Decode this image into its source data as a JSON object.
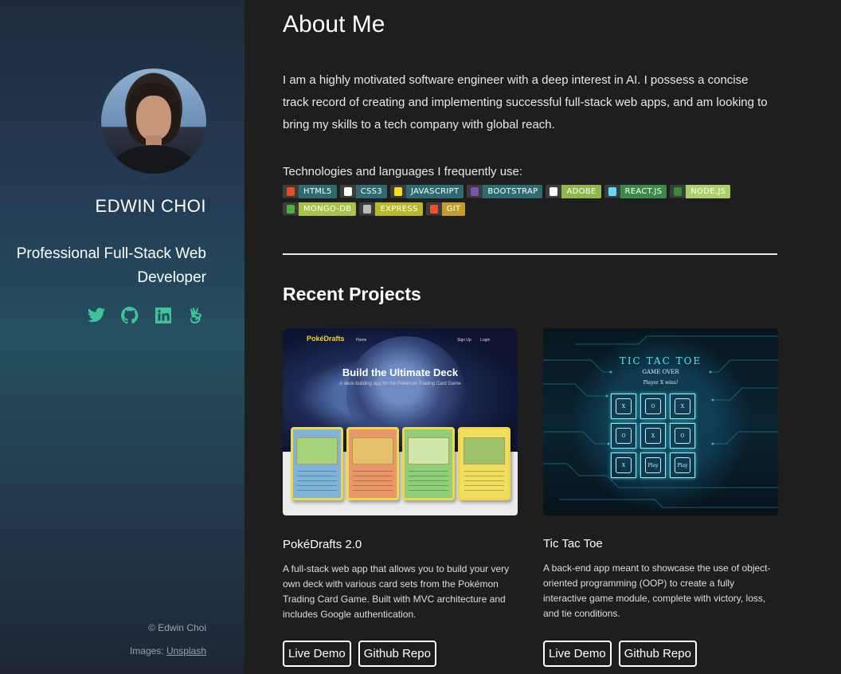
{
  "sidebar": {
    "name": "EDWIN CHOI",
    "title": "Professional Full-Stack Web Developer",
    "socials": [
      {
        "icon": "twitter-icon"
      },
      {
        "icon": "github-icon"
      },
      {
        "icon": "linkedin-icon"
      },
      {
        "icon": "angellist-icon"
      }
    ],
    "copyright": "© Edwin Choi",
    "credits_prefix": "Images: ",
    "credits_link": "Unsplash",
    "accent_color": "#3fc49a"
  },
  "about": {
    "heading": "About Me",
    "text": "I am a highly motivated software engineer with a deep interest in AI. I possess a concise track record of creating and implementing successful full-stack web apps, and am looking to bring my skills to a tech company with global reach.",
    "tech_label": "Technologies and languages I frequently use:",
    "badges": [
      {
        "label": "HTML5",
        "logo_bg": "#3c3c3c",
        "text_bg": "#2d6b70",
        "icon_color": "#e34f26"
      },
      {
        "label": "CSS3",
        "logo_bg": "#3c3c3c",
        "text_bg": "#2d6b70",
        "icon_color": "#ffffff"
      },
      {
        "label": "JAVASCRIPT",
        "logo_bg": "#3c3c3c",
        "text_bg": "#2d6b70",
        "icon_color": "#f7df1e"
      },
      {
        "label": "BOOTSTRAP",
        "logo_bg": "#3c3c3c",
        "text_bg": "#2d6b70",
        "icon_color": "#7952b3"
      },
      {
        "label": "ADOBE",
        "logo_bg": "#3c3c3c",
        "text_bg": "#8fb84b",
        "icon_color": "#ffffff"
      },
      {
        "label": "REACT.JS",
        "logo_bg": "#3c3c3c",
        "text_bg": "#3b8a4a",
        "icon_color": "#61dafb"
      },
      {
        "label": "NODE.JS",
        "logo_bg": "#3c3c3c",
        "text_bg": "#a9d06b",
        "icon_color": "#3c873a"
      },
      {
        "label": "MONGO-DB",
        "logo_bg": "#3c3c3c",
        "text_bg": "#a9c248",
        "icon_color": "#4db33d"
      },
      {
        "label": "EXPRESS",
        "logo_bg": "#3c3c3c",
        "text_bg": "#b7b82a",
        "icon_color": "#bbbbbb"
      },
      {
        "label": "GIT",
        "logo_bg": "#3c3c3c",
        "text_bg": "#c49c2d",
        "icon_color": "#f05032"
      }
    ]
  },
  "projects": {
    "heading": "Recent Projects",
    "items": [
      {
        "name": "PokéDrafts 2.0",
        "description": "A full-stack web app that allows you to build your very own deck with various card sets from the Pokémon Trading Card Game. Built with MVC architecture and includes Google authentication.",
        "thumb": {
          "logo": "PokéDrafts",
          "nav_home": "Home",
          "nav_signup": "Sign Up",
          "nav_login": "Login",
          "hero_title": "Build the Ultimate Deck",
          "hero_subtitle": "A deck-building app for the Pokémon Trading Card Game"
        },
        "live_demo": "Live Demo",
        "repo": "Github Repo"
      },
      {
        "name": "Tic Tac Toe",
        "description": "A back-end app meant to showcase the use of object-oriented programming (OOP) to create a fully interactive game module, complete with victory, loss, and tie conditions.",
        "thumb": {
          "title": "TIC TAC TOE",
          "status": "GAME OVER",
          "winner": "Player X wins!",
          "cells": [
            "X",
            "O",
            "X",
            "O",
            "X",
            "O",
            "X",
            "Play",
            "Play"
          ]
        },
        "live_demo": "Live Demo",
        "repo": "Github Repo"
      }
    ]
  }
}
